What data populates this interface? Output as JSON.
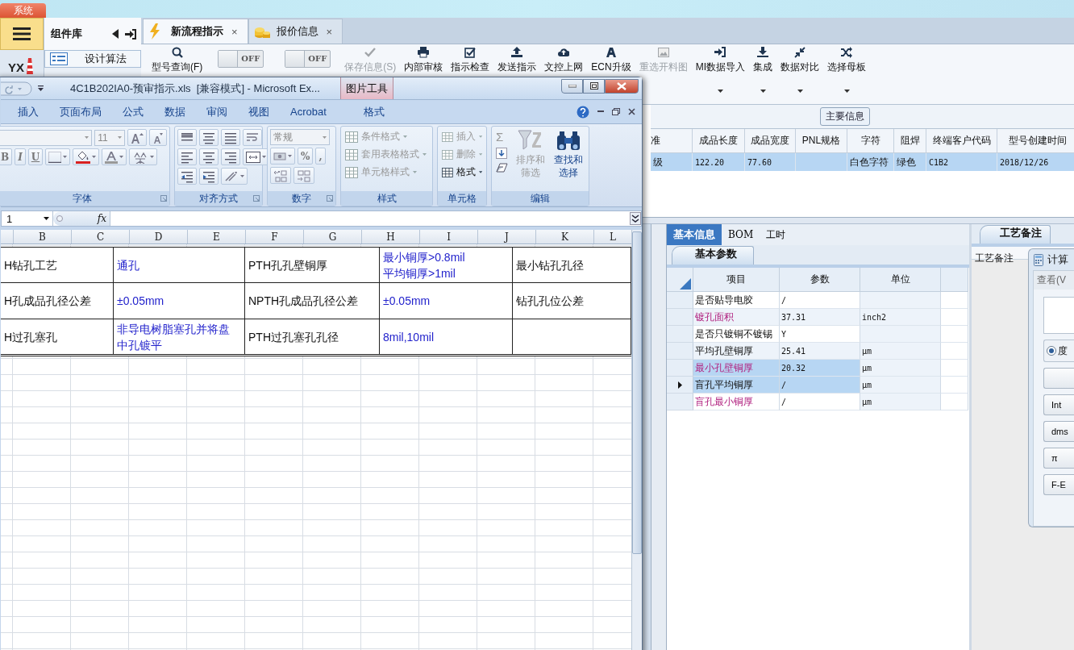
{
  "desktop_tab": "系统",
  "app": {
    "logo": "YX",
    "sidebar": {
      "title": "组件库",
      "items": [
        {
          "label": "设计算法",
          "selected": false
        }
      ]
    },
    "tabs": [
      {
        "label": "新流程指示",
        "selected": true,
        "close": "×"
      },
      {
        "label": "报价信息",
        "selected": false,
        "close": "×"
      }
    ],
    "toolbar": [
      {
        "kind": "button",
        "label": "型号查询(F)",
        "disabled": false,
        "dropdown": false
      },
      {
        "kind": "toggle",
        "text": "OFF",
        "on": false
      },
      {
        "kind": "toggle",
        "text": "OFF",
        "on": false
      },
      {
        "kind": "button",
        "label": "保存信息(S)",
        "disabled": true,
        "dropdown": false
      },
      {
        "kind": "button",
        "label": "内部审核",
        "disabled": false,
        "dropdown": false
      },
      {
        "kind": "button",
        "label": "指示检查",
        "disabled": false,
        "dropdown": false
      },
      {
        "kind": "button",
        "label": "发送指示",
        "disabled": false,
        "dropdown": false
      },
      {
        "kind": "button",
        "label": "文控上网",
        "disabled": false,
        "dropdown": false
      },
      {
        "kind": "button",
        "label": "ECN升级",
        "disabled": false,
        "dropdown": false
      },
      {
        "kind": "button",
        "label": "重选开料图",
        "disabled": true,
        "dropdown": false
      },
      {
        "kind": "button",
        "label": "MI数据导入",
        "disabled": false,
        "dropdown": true
      },
      {
        "kind": "button",
        "label": "集成",
        "disabled": false,
        "dropdown": true
      },
      {
        "kind": "button",
        "label": "数据对比",
        "disabled": false,
        "dropdown": true
      },
      {
        "kind": "button",
        "label": "选择母板",
        "disabled": false,
        "dropdown": true
      }
    ],
    "main_info": {
      "title": "主要信息",
      "columns": [
        "准",
        "成品长度",
        "成品宽度",
        "PNL规格",
        "字符",
        "阻焊",
        "终端客户代码",
        "型号创建时间"
      ],
      "rows": [
        {
          "selected": true,
          "cells": [
            "级",
            "122.20",
            "77.60",
            null,
            "白色字符",
            "绿色",
            "C1B2",
            "2018/12/26"
          ]
        }
      ]
    },
    "detail_tabs": [
      {
        "label": "基本信息",
        "selected": true
      },
      {
        "label": "BOM",
        "selected": false
      },
      {
        "label": "工时",
        "selected": false
      }
    ],
    "param_tab": {
      "label": "基本参数",
      "selected": true
    },
    "params": {
      "columns": [
        "项目",
        "参数",
        "单位"
      ],
      "rows": [
        {
          "item": "是否贴导电胶",
          "value": "/",
          "highlighted": false,
          "selected": false,
          "current": false
        },
        {
          "item": "镀孔面积",
          "value": "37.31",
          "unit": "inch2",
          "highlighted": true,
          "selected": false,
          "current": false
        },
        {
          "item": "是否只镀铜不镀锡",
          "value": "Y",
          "highlighted": false,
          "selected": false,
          "current": false
        },
        {
          "item": "平均孔壁铜厚",
          "value": "25.41",
          "unit": "μm",
          "highlighted": false,
          "selected": false,
          "current": false
        },
        {
          "item": "最小孔壁铜厚",
          "value": "20.32",
          "unit": "μm",
          "highlighted": true,
          "selected": true,
          "current": false
        },
        {
          "item": "盲孔平均铜厚",
          "value": "/",
          "unit": "μm",
          "highlighted": false,
          "selected": true,
          "current": true
        },
        {
          "item": "盲孔最小铜厚",
          "value": "/",
          "unit": "μm",
          "highlighted": true,
          "selected": false,
          "current": false
        }
      ]
    },
    "remarks": {
      "tab": "工艺备注",
      "label": "工艺备注"
    },
    "calculator": {
      "title": "计算",
      "menu": "查看(V",
      "radio": {
        "label": "度",
        "selected": true
      },
      "buttons": [
        {
          "label": "Int"
        },
        {
          "label": "dms"
        },
        {
          "label": "π"
        },
        {
          "label": "F-E"
        }
      ]
    }
  },
  "excel": {
    "title": "4C1B202IA0-预审指示.xls  [兼容模式] - Microsoft Ex...",
    "context_tab": "图片工具",
    "ribbon_tabs": [
      {
        "label": "插入",
        "selected": false
      },
      {
        "label": "页面布局",
        "selected": false
      },
      {
        "label": "公式",
        "selected": false
      },
      {
        "label": "数据",
        "selected": false
      },
      {
        "label": "审阅",
        "selected": false
      },
      {
        "label": "视图",
        "selected": false
      },
      {
        "label": "Acrobat",
        "selected": false
      },
      {
        "label": "格式",
        "selected": false
      }
    ],
    "groups": [
      {
        "kind": "font",
        "label": "字体",
        "size": "11",
        "styles": [
          "B",
          "I",
          "U"
        ]
      },
      {
        "kind": "align",
        "label": "对齐方式"
      },
      {
        "kind": "number",
        "label": "数字",
        "format": "常规",
        "symbols": [
          "%",
          ","
        ]
      },
      {
        "kind": "commands",
        "label": "样式",
        "commands": [
          {
            "label": "条件格式",
            "disabled": true
          },
          {
            "label": "套用表格格式",
            "disabled": true
          },
          {
            "label": "单元格样式",
            "disabled": true
          }
        ]
      },
      {
        "kind": "commands",
        "label": "单元格",
        "commands": [
          {
            "label": "插入",
            "disabled": true
          },
          {
            "label": "删除",
            "disabled": true
          },
          {
            "label": "格式",
            "disabled": false
          }
        ]
      },
      {
        "kind": "edit",
        "label": "编辑",
        "sum": "Σ",
        "commands": [
          {
            "lines": [
              "排序和",
              "筛选"
            ],
            "disabled": true
          },
          {
            "lines": [
              "查找和",
              "选择"
            ],
            "disabled": false
          }
        ]
      }
    ],
    "name_box": "1",
    "fx": "fx",
    "columns": [
      "B",
      "C",
      "D",
      "E",
      "F",
      "G",
      "H",
      "I",
      "J",
      "K",
      "L"
    ],
    "sheet_rows": [
      [
        {
          "text": "H钻孔工艺",
          "highlighted": false
        },
        {
          "text": "通孔",
          "highlighted": true
        },
        {
          "text": "PTH孔孔壁铜厚",
          "highlighted": false
        },
        {
          "lines": [
            "最小铜厚>0.8mil",
            "平均铜厚>1mil"
          ],
          "highlighted": true
        },
        {
          "text": "最小钻孔孔径",
          "highlighted": false
        }
      ],
      [
        {
          "text": "H孔成品孔径公差",
          "highlighted": false
        },
        {
          "text": "±0.05mm",
          "highlighted": true
        },
        {
          "text": "NPTH孔成品孔径公差",
          "highlighted": false
        },
        {
          "text": "±0.05mm",
          "highlighted": true
        },
        {
          "text": "钻孔孔位公差",
          "highlighted": false
        }
      ],
      [
        {
          "text": "H过孔塞孔",
          "highlighted": false
        },
        {
          "lines": [
            "非导电树脂塞孔并将盘",
            "中孔镀平"
          ],
          "highlighted": true
        },
        {
          "text": "PTH过孔塞孔孔径",
          "highlighted": false
        },
        {
          "text": "8mil,10mil",
          "highlighted": true
        }
      ]
    ]
  }
}
